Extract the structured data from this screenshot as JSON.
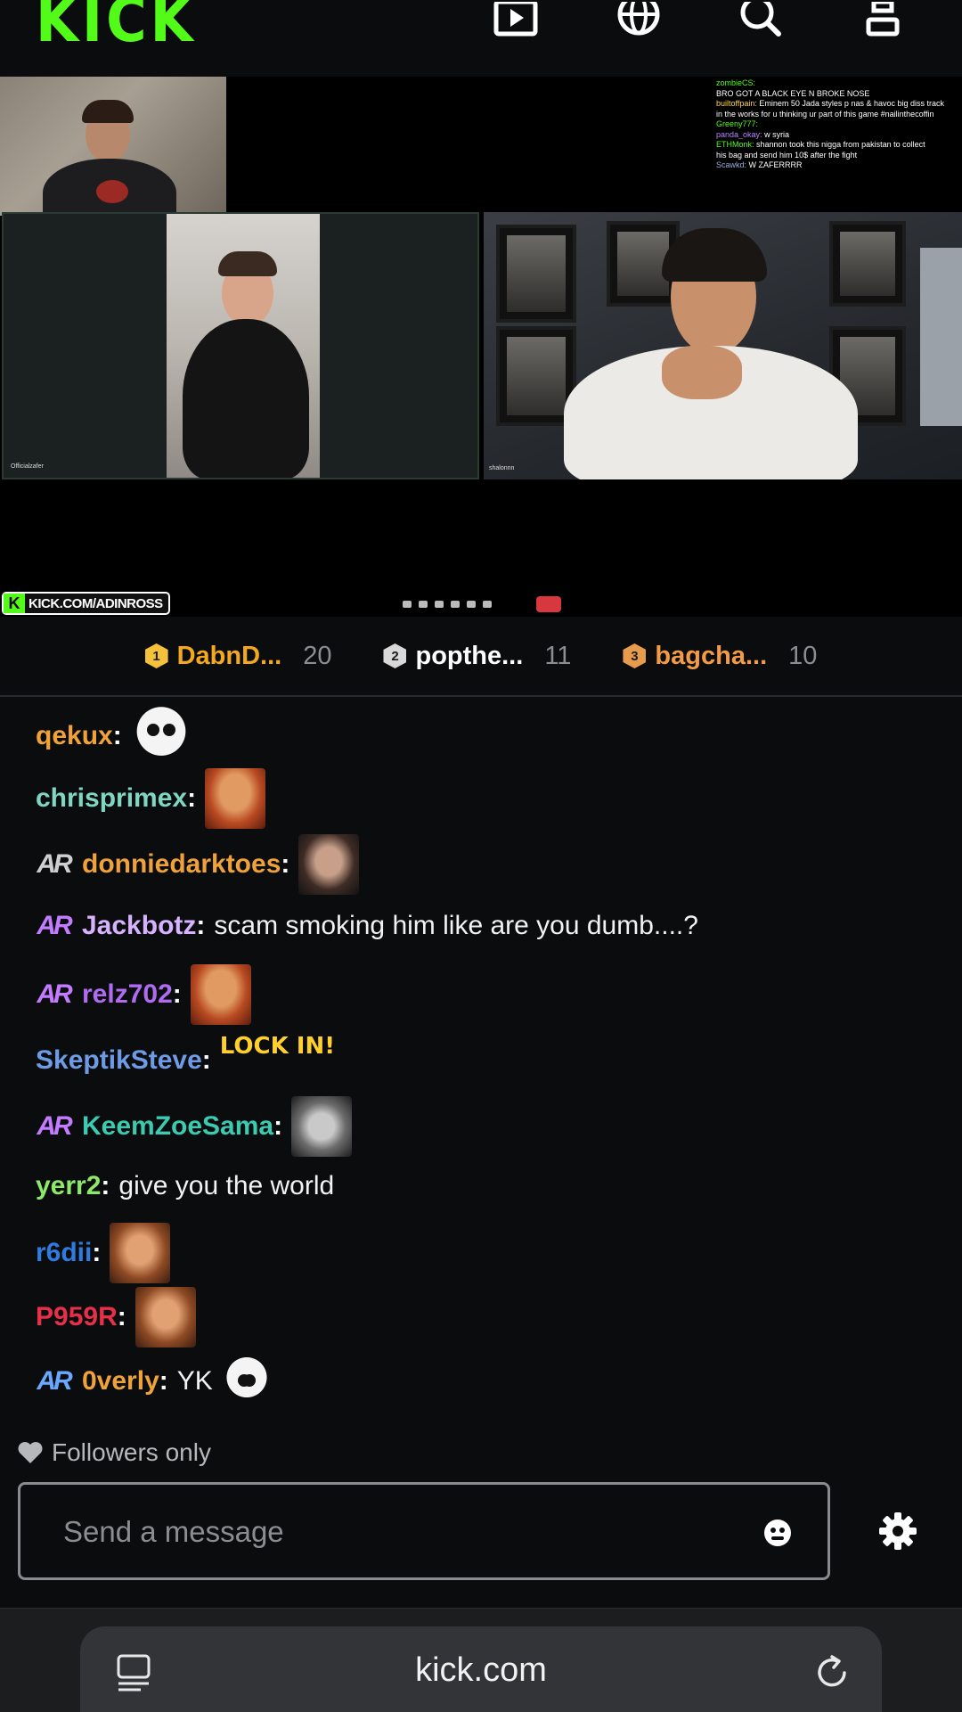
{
  "nav": {
    "logo": "KICK",
    "icons": [
      "video-icon",
      "globe-icon",
      "search-icon",
      "user-icon"
    ]
  },
  "video": {
    "overlay_chat": [
      {
        "user": "zombieCS:",
        "text": ""
      },
      {
        "user": "",
        "text": "BRO GOT A BLACK EYE N BROKE NOSE"
      },
      {
        "user": "builtoffpain:",
        "text": "Eminem 50 Jada styles p nas & havoc big diss track"
      },
      {
        "user": "",
        "text": "in the works for u thinking ur part of this game #nailinthecoffin"
      },
      {
        "user": "Greeny777:",
        "text": ""
      },
      {
        "user": "panda_okay:",
        "text": "w syria"
      },
      {
        "user": "ETHMonk:",
        "text": "shannon took this nigga from pakistan to collect"
      },
      {
        "user": "",
        "text": "his bag and send him 10$ after the fight"
      },
      {
        "user": "Scawkd:",
        "text": "W ZAFERRRR"
      }
    ],
    "stream_badge": "KICK.COM/ADINROSS",
    "badge_k": "K",
    "cam2_label": "Officialzafer",
    "cam3_label": "shalonnn"
  },
  "leaderboard": [
    {
      "rank": "1",
      "name": "DabnD...",
      "count": "20",
      "color": "#f4a81d",
      "rank_bg": "#f4c23a"
    },
    {
      "rank": "2",
      "name": "popthe...",
      "count": "11",
      "color": "#ffffff",
      "rank_bg": "#d9d9d9"
    },
    {
      "rank": "3",
      "name": "bagcha...",
      "count": "10",
      "color": "#f39a45",
      "rank_bg": "#e79b4c"
    }
  ],
  "chat": [
    {
      "name": "qekux",
      "color": "#f0a23a",
      "text": "",
      "emote": "skull-emote",
      "badge": false
    },
    {
      "name": "chrisprimex",
      "color": "#7ed6c3",
      "text": "",
      "emote": "face-emote",
      "badge": false
    },
    {
      "name": "donniedarktoes",
      "color": "#f0a23a",
      "text": "",
      "emote": "laugh-emote",
      "badge": true,
      "badge_color": "#cfcfcf"
    },
    {
      "name": "Jackbotz",
      "color": "#d7b3ff",
      "text": "scam smoking him like are you dumb....?",
      "emote": "",
      "badge": true,
      "badge_color": "#c37cff"
    },
    {
      "name": "relz702",
      "color": "#b06cf0",
      "text": "",
      "emote": "face-emote",
      "badge": true,
      "badge_color": "#c37cff"
    },
    {
      "name": "SkeptikSteve",
      "color": "#6f9be6",
      "text": "",
      "emote": "lock-in-emote",
      "badge": false
    },
    {
      "name": "KeemZoeSama",
      "color": "#3ccab0",
      "text": "",
      "emote": "grin-emote",
      "badge": true,
      "badge_color": "#c37cff"
    },
    {
      "name": "yerr2",
      "color": "#8ee86a",
      "text": "give you the world",
      "emote": "",
      "badge": false
    },
    {
      "name": "r6dii",
      "color": "#2f7be0",
      "text": "",
      "emote": "kid-emote",
      "badge": false
    },
    {
      "name": "P959R",
      "color": "#e6304a",
      "text": "",
      "emote": "kid-emote",
      "badge": false
    },
    {
      "name": "0verly",
      "color": "#f0a23a",
      "text": "YK",
      "emote": "skull-emote",
      "badge": true,
      "badge_color": "#6aa8ff"
    }
  ],
  "badge_text": "AR",
  "lock_emote_text": "LOCK IN!",
  "chat_input": {
    "followers_only": "Followers only",
    "placeholder": "Send a message"
  },
  "browser": {
    "url": "kick.com"
  }
}
